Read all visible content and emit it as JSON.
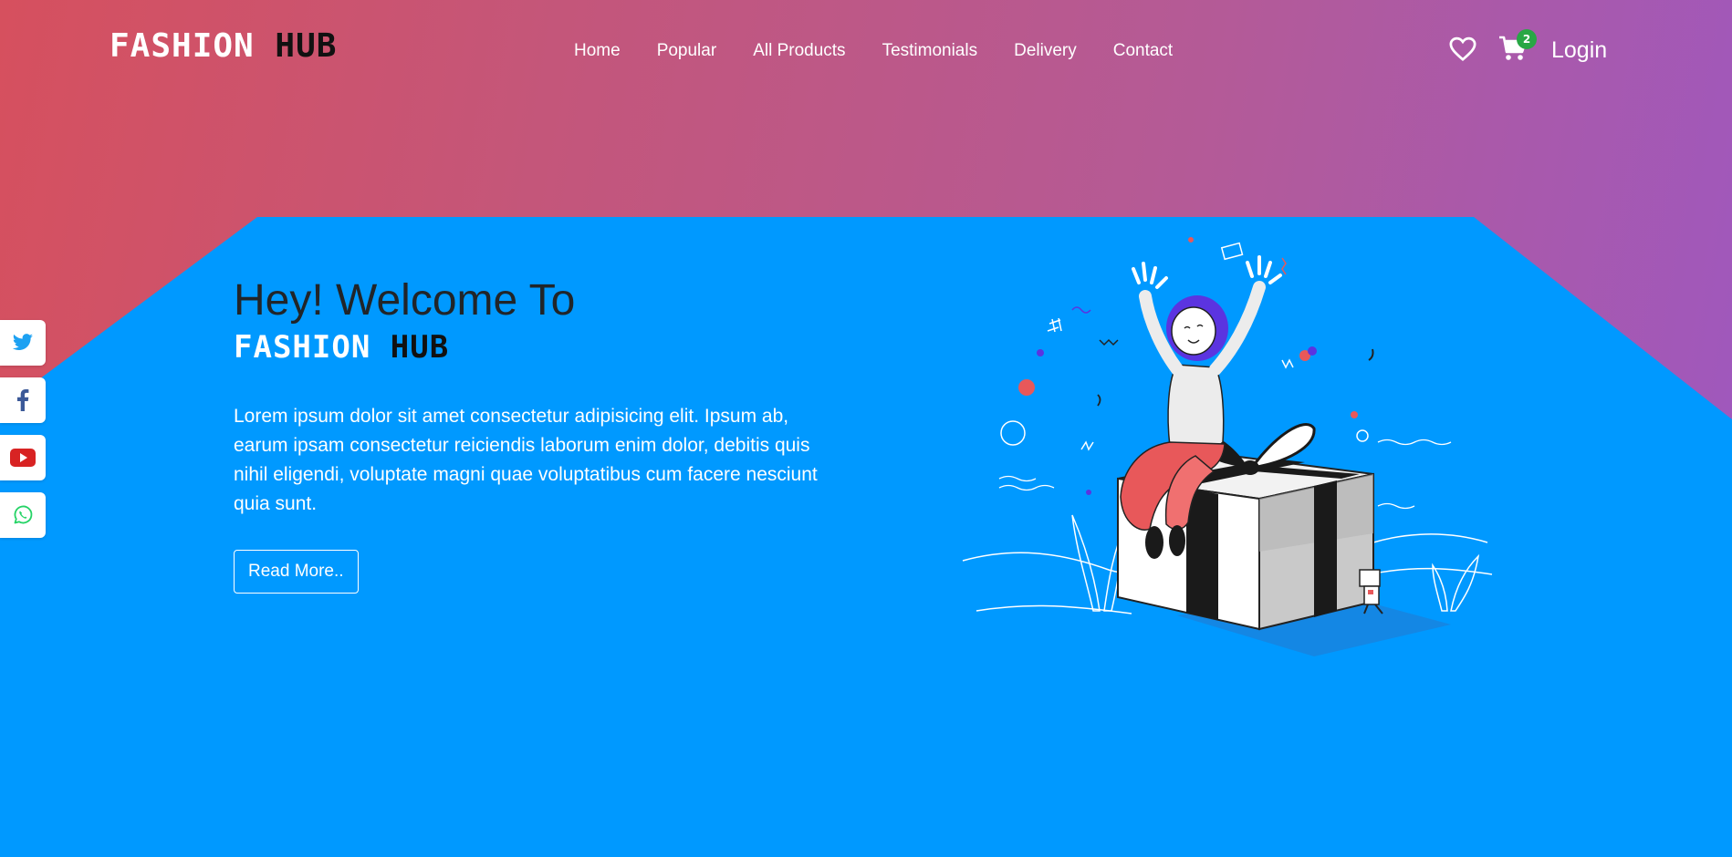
{
  "header": {
    "logo": {
      "fashion": "FASHION",
      "hub": "HUB"
    },
    "nav": [
      {
        "label": "Home"
      },
      {
        "label": "Popular"
      },
      {
        "label": "All Products"
      },
      {
        "label": "Testimonials"
      },
      {
        "label": "Delivery"
      },
      {
        "label": "Contact"
      }
    ],
    "cart_count": "2",
    "login_label": "Login"
  },
  "social": [
    {
      "name": "twitter-icon",
      "color": "#1da1f2"
    },
    {
      "name": "facebook-icon",
      "color": "#3b5998"
    },
    {
      "name": "youtube-icon",
      "color": "#d82323"
    },
    {
      "name": "whatsapp-icon",
      "color": "#25d366"
    }
  ],
  "hero": {
    "title": "Hey! Welcome To",
    "brand": {
      "fashion": "FASHION",
      "hub": "HUB"
    },
    "description": "Lorem ipsum dolor sit amet consectetur adipisicing elit. Ipsum ab, earum ipsam consectetur reiciendis laborum enim dolor, debitis quis nihil eligendi, voluptate magni quae voluptatibus cum facere nesciunt quia sunt.",
    "button_label": "Read More.."
  },
  "colors": {
    "hero_blue": "#0099ff",
    "gradient_start": "#d6505e",
    "gradient_end": "#9d58c1",
    "badge_green": "#28a745"
  }
}
